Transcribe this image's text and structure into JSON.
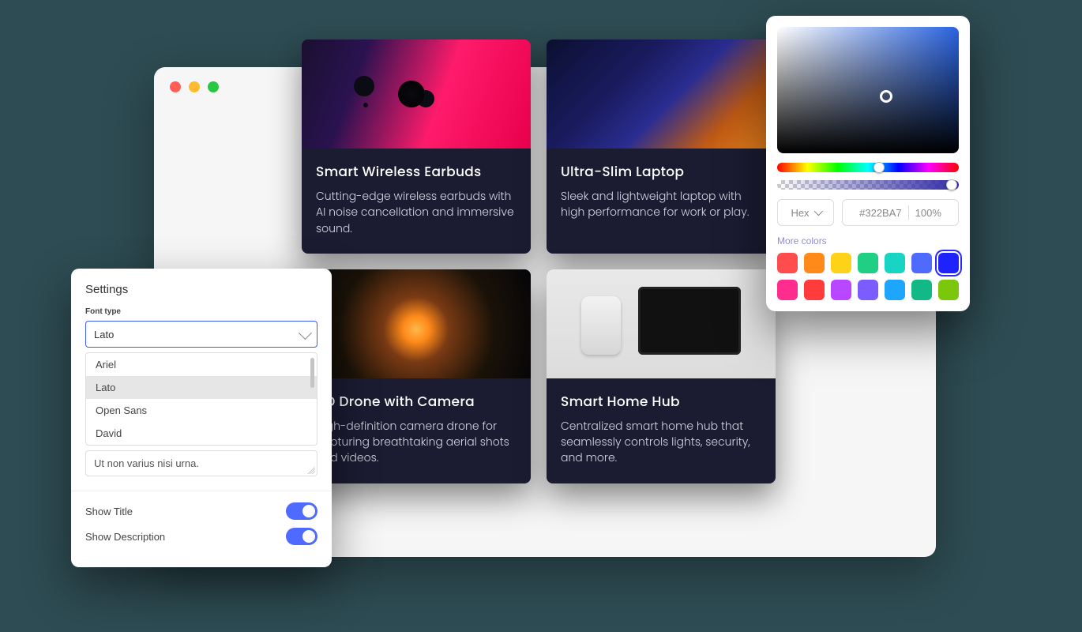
{
  "cards": [
    {
      "title": "Smart Wireless Earbuds",
      "desc": "Cutting-edge wireless earbuds with AI noise cancellation and immersive sound."
    },
    {
      "title": "Ultra-Slim Laptop",
      "desc": "Sleek and lightweight laptop with high performance for work or play."
    },
    {
      "title": "HD Drone with Camera",
      "desc": "High-definition camera drone for capturing breathtaking aerial shots and videos."
    },
    {
      "title": "Smart Home Hub",
      "desc": "Centralized smart home hub that seamlessly controls lights, security, and more."
    }
  ],
  "settings": {
    "heading": "Settings",
    "font_label": "Font type",
    "font_value": "Lato",
    "options": [
      "Ariel",
      "Lato",
      "Open Sans",
      "David"
    ],
    "textarea_value": "Ut non varius nisi urna.",
    "show_title_label": "Show Title",
    "show_desc_label": "Show Description"
  },
  "picker": {
    "mode": "Hex",
    "hex": "#322BA7",
    "opacity": "100%",
    "more_label": "More colors",
    "swatches": [
      "#ff4d4d",
      "#ff8a1a",
      "#ffd21a",
      "#1ecf84",
      "#17d5c2",
      "#4f6bff",
      "#1e22ff",
      "#ff2e8e",
      "#ff3b3b",
      "#b847ff",
      "#7a5cff",
      "#1ea6ff",
      "#12b886",
      "#7ac70c"
    ],
    "active_swatch": 6
  }
}
